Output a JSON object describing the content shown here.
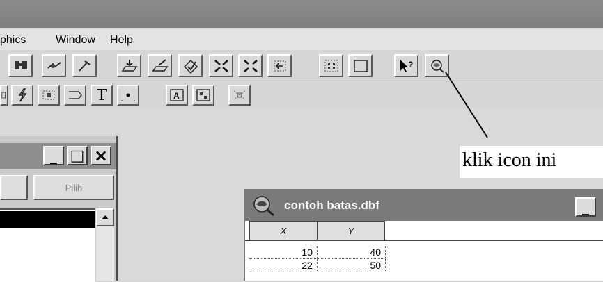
{
  "menu": {
    "graphics_partial": "phics",
    "window_first": "W",
    "window_rest": "indow",
    "help_first": "H",
    "help_rest": "elp"
  },
  "toolbar1": {
    "icons": [
      "find-icon",
      "hotlink-icon",
      "tool-icon",
      "load-icon",
      "edit-icon",
      "select-icon",
      "shrink-icon",
      "expand-icon",
      "back-icon",
      "grid-icon",
      "frame-icon",
      "help-pointer-icon",
      "identify-icon"
    ]
  },
  "toolbar2": {
    "icons": [
      "partial-icon",
      "lightning-icon",
      "box-icon",
      "label-icon",
      "text-tool-icon",
      "point-icon",
      "text-frame-icon",
      "legend-icon",
      "dots-icon"
    ],
    "text_tool_label": "T"
  },
  "left_window": {
    "min": "_",
    "max": "□",
    "close": "×",
    "pilih_button": "Pilih"
  },
  "table_window": {
    "title": "contoh batas.dbf",
    "min": "_",
    "columns": [
      "X",
      "Y"
    ],
    "rows": [
      [
        "10",
        "40"
      ],
      [
        "22",
        "50"
      ]
    ]
  },
  "annotation": "klik icon ini",
  "colors": {
    "titlebar": "#8c8c8c",
    "face": "#d6d6d6",
    "selection": "#000000"
  }
}
